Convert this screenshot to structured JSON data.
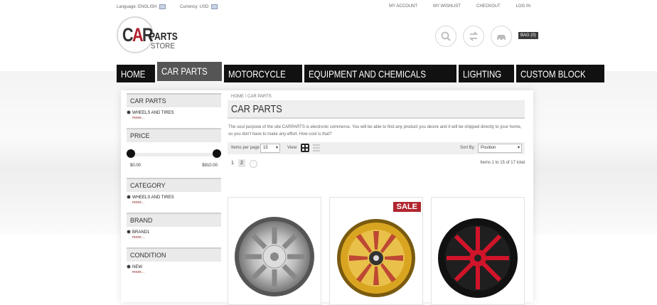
{
  "topbar": {
    "language_label": "Language:",
    "language_value": "ENGLISH",
    "currency_label": "Currency:",
    "currency_value": "USD",
    "links": [
      "MY ACCOUNT",
      "MY WISHLIST",
      "CHECKOUT",
      "LOG IN"
    ]
  },
  "logo": {
    "c": "C",
    "a": "A",
    "r": "R",
    "parts": "PARTS",
    "store": "STORE"
  },
  "header": {
    "bag_label": "BAG (0)"
  },
  "nav": [
    "HOME",
    "CAR PARTS",
    "MOTORCYCLE",
    "EQUIPMENT AND CHEMICALS",
    "LIGHTING",
    "CUSTOM BLOCK"
  ],
  "nav_active": "CAR PARTS",
  "sidebar": {
    "car_parts": {
      "title": "CAR PARTS",
      "option": "WHEELS AND TIRES",
      "more": "more..."
    },
    "price": {
      "title": "PRICE",
      "min": "$0.00",
      "max": "$910.00"
    },
    "category": {
      "title": "CATEGORY",
      "option": "WHEELS AND TIRES",
      "more": "more..."
    },
    "brand": {
      "title": "BRAND",
      "option": "BRAND1",
      "more": "more..."
    },
    "condition": {
      "title": "CONDITION",
      "option": "NEW",
      "more": "more..."
    }
  },
  "main": {
    "breadcrumb": "HOME / CAR PARTS",
    "title": "CAR PARTS",
    "description": "The soul purpose of the site CARPARTS is electronic commerce. You will be able to find any product you desire and it will be shipped directly to your home, so you don't have to make any effort. How cool is that?",
    "toolbar": {
      "items_per_page_label": "Items per page",
      "items_per_page_value": "15",
      "view_label": "View:",
      "sort_label": "Sort By:",
      "sort_value": "Position"
    },
    "pager": {
      "page1": "1",
      "page2": "2",
      "next": "›",
      "items_info": "Items 1 to 15 of 17 total"
    }
  },
  "products": [
    {
      "badge": ""
    },
    {
      "badge": "SALE"
    },
    {
      "badge": ""
    }
  ],
  "colors": {
    "nav_bg": "#111111",
    "nav_active": "#555555",
    "accent_red": "#b0252e"
  }
}
